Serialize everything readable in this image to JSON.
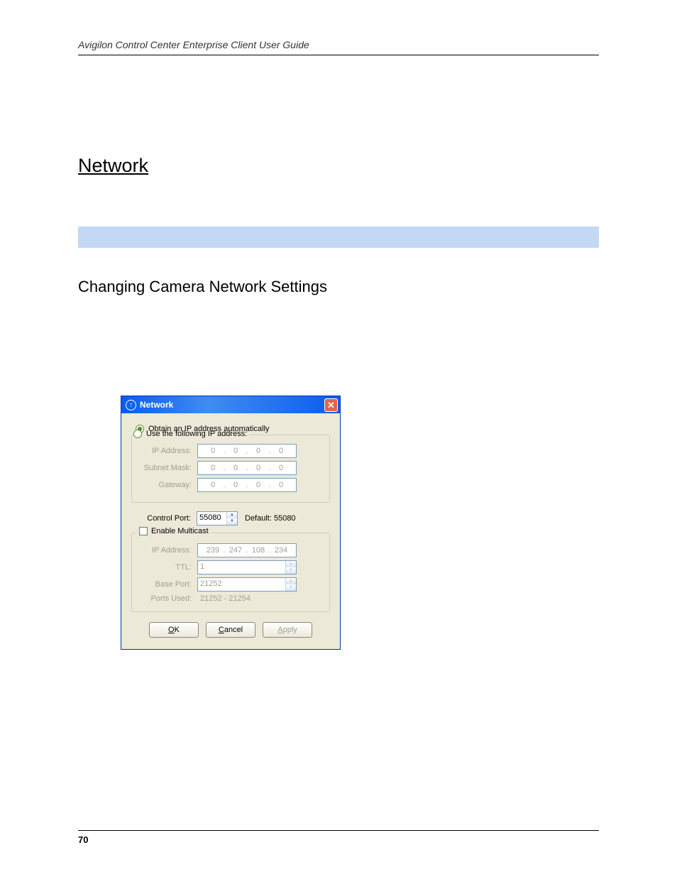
{
  "doc": {
    "header": "Avigilon Control Center Enterprise Client User Guide",
    "section_title": "Network",
    "subsection_title": "Changing Camera Network Settings",
    "page_number": "70"
  },
  "dialog": {
    "title": "Network",
    "radio_auto": "Obtain an IP address automatically",
    "radio_manual": "Use the following IP address:",
    "labels": {
      "ip_address": "IP Address:",
      "subnet_mask": "Subnet Mask:",
      "gateway": "Gateway:",
      "control_port": "Control Port:",
      "default_port": "Default: 55080",
      "enable_multicast": "Enable Multicast",
      "mc_ip": "IP Address:",
      "ttl": "TTL:",
      "base_port": "Base Port:",
      "ports_used": "Ports Used:"
    },
    "values": {
      "ip": [
        "0",
        "0",
        "0",
        "0"
      ],
      "subnet": [
        "0",
        "0",
        "0",
        "0"
      ],
      "gateway": [
        "0",
        "0",
        "0",
        "0"
      ],
      "control_port": "55080",
      "mc_ip": [
        "239",
        "247",
        "108",
        "234"
      ],
      "ttl": "1",
      "base_port": "21252",
      "ports_used": "21252 - 21254"
    },
    "buttons": {
      "ok": "OK",
      "cancel": "Cancel",
      "apply": "Apply"
    }
  }
}
